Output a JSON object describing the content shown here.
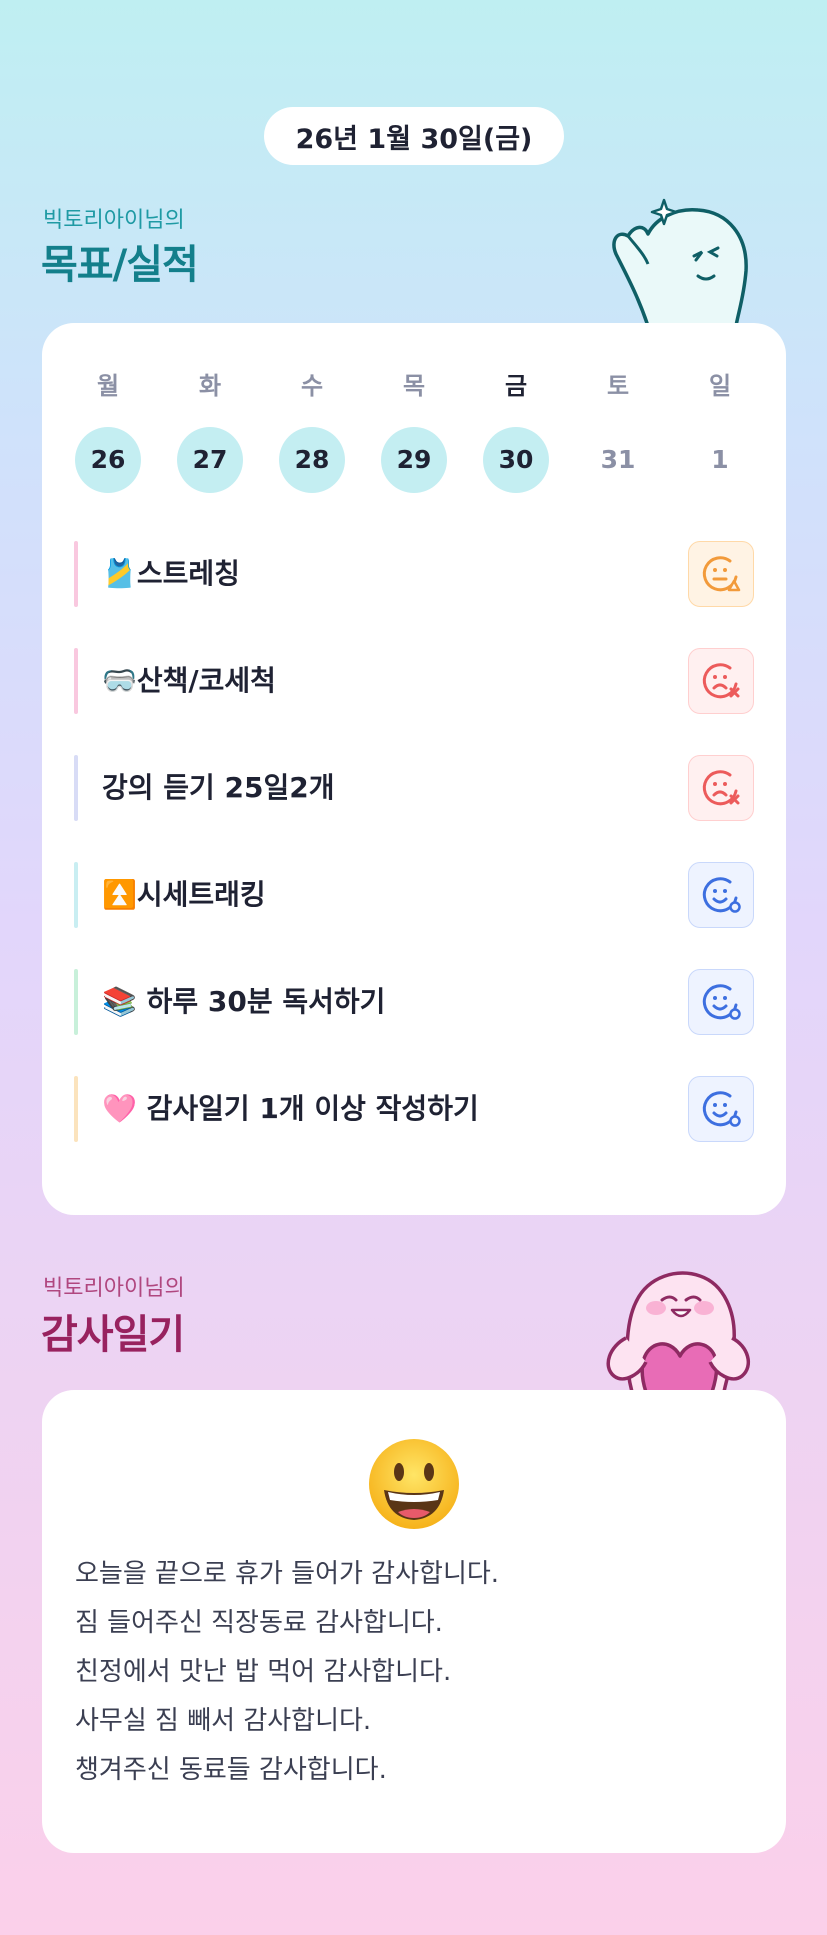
{
  "header": {
    "date": "26년 1월 30일(금)"
  },
  "goals_section": {
    "subtitle": "빅토리아이님의",
    "title": "목표/실적"
  },
  "week": [
    {
      "weekday": "월",
      "day": "26",
      "state": "filled"
    },
    {
      "weekday": "화",
      "day": "27",
      "state": "filled"
    },
    {
      "weekday": "수",
      "day": "28",
      "state": "filled"
    },
    {
      "weekday": "목",
      "day": "29",
      "state": "filled"
    },
    {
      "weekday": "금",
      "day": "30",
      "state": "filled-active"
    },
    {
      "weekday": "토",
      "day": "31",
      "state": "future"
    },
    {
      "weekday": "일",
      "day": "1",
      "state": "future"
    }
  ],
  "goals": [
    {
      "emoji": "🎽",
      "text": "스트레칭",
      "status": "partial",
      "status_icon": "smile-triangle-icon",
      "bar_color": "#f9c8df"
    },
    {
      "emoji": "🥽",
      "text": "산책/코세척",
      "status": "fail",
      "status_icon": "frown-x-icon",
      "bar_color": "#f9c8df"
    },
    {
      "emoji": "",
      "text": "강의 듣기 25일2개",
      "status": "fail",
      "status_icon": "frown-x-icon",
      "bar_color": "#d8dcf6"
    },
    {
      "emoji": "⏫",
      "text": "시세트래킹",
      "status": "done",
      "status_icon": "smile-circle-icon",
      "bar_color": "#c9eef2"
    },
    {
      "emoji": "📚",
      "text": " 하루 30분 독서하기",
      "status": "done",
      "status_icon": "smile-circle-icon",
      "bar_color": "#c8f0da"
    },
    {
      "emoji": "🩷",
      "text": " 감사일기 1개 이상 작성하기",
      "status": "done",
      "status_icon": "smile-circle-icon",
      "bar_color": "#fbe3bd"
    }
  ],
  "gratitude_section": {
    "subtitle": "빅토리아이님의",
    "title": "감사일기"
  },
  "gratitude": {
    "mood_icon": "grinning-face-icon",
    "lines": [
      "오늘을 끝으로 휴가 들어가 감사합니다.",
      "짐 들어주신 직장동료 감사합니다.",
      "친정에서 맛난 밥 먹어 감사합니다.",
      "사무실 짐 빼서 감사합니다.",
      "챙겨주신 동료들 감사합니다."
    ]
  },
  "colors": {
    "goal_title": "#137f8b",
    "gratitude_title": "#98225f",
    "status_partial": "#f29a3a",
    "status_fail": "#ec5b5b",
    "status_done": "#3d6fe0"
  }
}
